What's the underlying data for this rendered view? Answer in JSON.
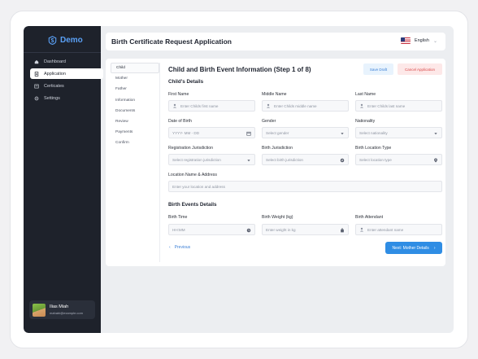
{
  "app": {
    "brand": "Demo"
  },
  "sidebar": {
    "items": [
      {
        "label": "Dashboard",
        "icon": "home-icon"
      },
      {
        "label": "Application",
        "icon": "document-icon",
        "active": true
      },
      {
        "label": "Certicates",
        "icon": "certificate-icon"
      },
      {
        "label": "Settings",
        "icon": "gear-icon"
      }
    ]
  },
  "user": {
    "name": "Ilias Miah",
    "email": "mahabi@example.com"
  },
  "header": {
    "title": "Birth Certificate Request Application",
    "language": "English"
  },
  "steps": [
    "Child",
    "Mother",
    "Father",
    "Information",
    "Documents",
    "Review",
    "Payments",
    "Confirm"
  ],
  "form": {
    "title": "Child and Birth Event Information (Step 1 of 8)",
    "save_label": "Save Draft",
    "cancel_label": "Cancel Application",
    "section_child": "Child's Details",
    "first_name": {
      "label": "First Name",
      "placeholder": "Enter Childs first name"
    },
    "middle_name": {
      "label": "Middle Name",
      "placeholder": "Enter Childs middle name"
    },
    "last_name": {
      "label": "Last Name",
      "placeholder": "Enter Childs last name"
    },
    "dob": {
      "label": "Date of Birth",
      "placeholder": "YYYY- MM - DD"
    },
    "gender": {
      "label": "Gender",
      "placeholder": "Select gender"
    },
    "nationality": {
      "label": "Nationality",
      "placeholder": "Select nationality"
    },
    "reg_jurisdiction": {
      "label": "Registration Jurisdiction",
      "placeholder": "Select registration jurisdiction"
    },
    "birth_jurisdiction": {
      "label": "Birth Jurisdiction",
      "placeholder": "Select birth jurisdiction"
    },
    "birth_location_type": {
      "label": "Birth Location Type",
      "placeholder": "Select location type"
    },
    "location": {
      "label": "Location Name & Address",
      "placeholder": "Enter your location and address"
    },
    "section_birth": "Birth Events Details",
    "birth_time": {
      "label": "Birth Time",
      "placeholder": "HH:MM"
    },
    "birth_weight": {
      "label": "Birth Weight  (kg)",
      "placeholder": "Enter weight in kg"
    },
    "birth_attendant": {
      "label": "Birth Attendant",
      "placeholder": "Enter attendant name"
    },
    "prev_label": "Previous",
    "next_label": "Next: Mother Details"
  },
  "colors": {
    "accent": "#2f8de4",
    "sidebar": "#1e222b",
    "danger": "#d94a4a"
  }
}
